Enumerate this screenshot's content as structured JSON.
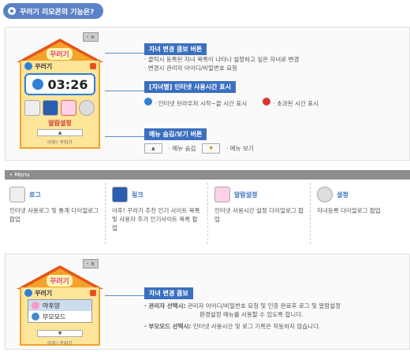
{
  "header": {
    "title": "꾸러기 리모콘의 기능은?"
  },
  "widget1": {
    "logo": "꾸러기",
    "window_title": "꾸러기",
    "time": "03:26",
    "alarm_label": "알람설정",
    "footer": "아후! 꾸러기",
    "chimney": "- ×"
  },
  "annotations": {
    "child_change": {
      "title": "자녀 변경 콤보 버튼",
      "line1": "· 클릭시 등록된 자녀 목록이 나타나 설정하고 싶은 자녀로 변경",
      "line2": "· 변경시 관리자 아이디/비밀번호 요청"
    },
    "usage": {
      "title": "[자녀별] 인터넷 사용시간 표시",
      "item1": "· 인터넷 브라우저 시작~끝 시간 표시",
      "item2": "· 초과된 시간 표시"
    },
    "menu_toggle": {
      "title": "메뉴 숨김/보기 버튼",
      "hide": "· 메뉴 숨김",
      "show": "· 메뉴 보기"
    }
  },
  "menu": {
    "bar_label": "• Menu",
    "items": [
      {
        "title": "로그",
        "desc": "인터넷 사용로그 및 통계 다이얼로그 팝업"
      },
      {
        "title": "링크",
        "desc": "야후! 꾸러기 추천 인기 사이트 목록 및 사용자 추가 인기사이트 목록 팝업"
      },
      {
        "title": "알람설정",
        "desc": "인터넷 사용시간 설정 다이얼로그 팝업"
      },
      {
        "title": "설정",
        "desc": "자녀등록 다이얼로그 팝업"
      }
    ]
  },
  "widget2": {
    "logo": "꾸러기",
    "window_title": "꾸러기",
    "options": [
      "야후양",
      "부모모드"
    ],
    "footer": "아후! 꾸러기"
  },
  "combo": {
    "title": "자녀 변경 콤보",
    "admin_label": "· 관리자 선택시:",
    "admin_desc": "관리자 아이디/비밀번호 요청 및 인증 완료후 로그 및 알람설정",
    "admin_desc2": "환경설정 메뉴를 사용할 수 있도록 합니다.",
    "parent_label": "· 부모모드 선택시:",
    "parent_desc": "인터넷 사용시간 및 로그 기록은 작동하지 않습니다."
  }
}
